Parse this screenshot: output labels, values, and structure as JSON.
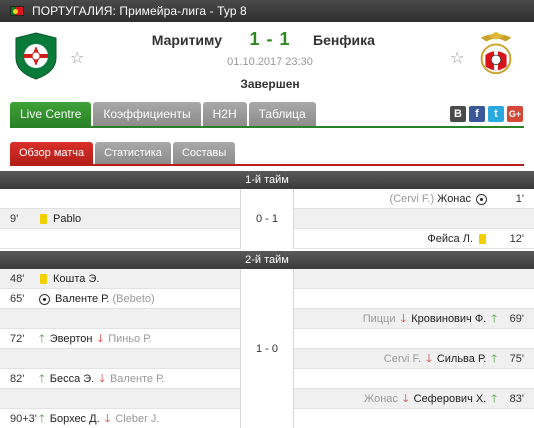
{
  "topbar": {
    "league": "ПОРТУГАЛИЯ: Примейра-лига - Тур 8"
  },
  "match": {
    "home_team": "Маритиму",
    "away_team": "Бенфика",
    "score": "1 - 1",
    "datetime": "01.10.2017 23:30",
    "status": "Завершен"
  },
  "home_logo_text": "Maritimo",
  "home_logo_sub": "Madeira",
  "tabs": [
    "Live Centre",
    "Коэффициенты",
    "H2H",
    "Таблица"
  ],
  "subtabs": [
    "Обзор матча",
    "Статистика",
    "Составы"
  ],
  "social": {
    "vk": "B",
    "fb": "f",
    "tw": "t",
    "gp": "G+"
  },
  "half1": {
    "title": "1-й тайм",
    "score": "0 - 1",
    "events": [
      {
        "side": "away",
        "type": "goal",
        "minute": "1'",
        "player": "Жонас",
        "assist": "(Cervi F.)"
      },
      {
        "side": "home",
        "type": "yellow",
        "minute": "9'",
        "player": "Pablo"
      },
      {
        "side": "away",
        "type": "yellow",
        "minute": "12'",
        "player": "Фейса Л."
      }
    ]
  },
  "half2": {
    "title": "2-й тайм",
    "score": "1 - 0",
    "events": [
      {
        "side": "home",
        "type": "yellow",
        "minute": "48'",
        "player": "Кошта Э."
      },
      {
        "side": "home",
        "type": "goal",
        "minute": "65'",
        "player": "Валенте Р.",
        "assist": "(Bebeto)"
      },
      {
        "side": "away",
        "type": "sub",
        "minute": "69'",
        "in": "Кровинович Ф.",
        "out": "Пицци"
      },
      {
        "side": "home",
        "type": "sub",
        "minute": "72'",
        "in": "Эвертон",
        "out": "Пиньо Р."
      },
      {
        "side": "away",
        "type": "sub",
        "minute": "75'",
        "in": "Сильва Р.",
        "out": "Cervi F."
      },
      {
        "side": "home",
        "type": "sub",
        "minute": "82'",
        "in": "Бесса Э.",
        "out": "Валенте Р."
      },
      {
        "side": "away",
        "type": "sub",
        "minute": "83'",
        "in": "Сеферович Х.",
        "out": "Жонас"
      },
      {
        "side": "home",
        "type": "sub",
        "minute": "90+3'",
        "in": "Борхес Д.",
        "out": "Cleber J."
      }
    ]
  },
  "colors": {
    "accent_green": "#2a8126",
    "accent_red": "#b51e18",
    "yellow_card": "#f2d000"
  }
}
